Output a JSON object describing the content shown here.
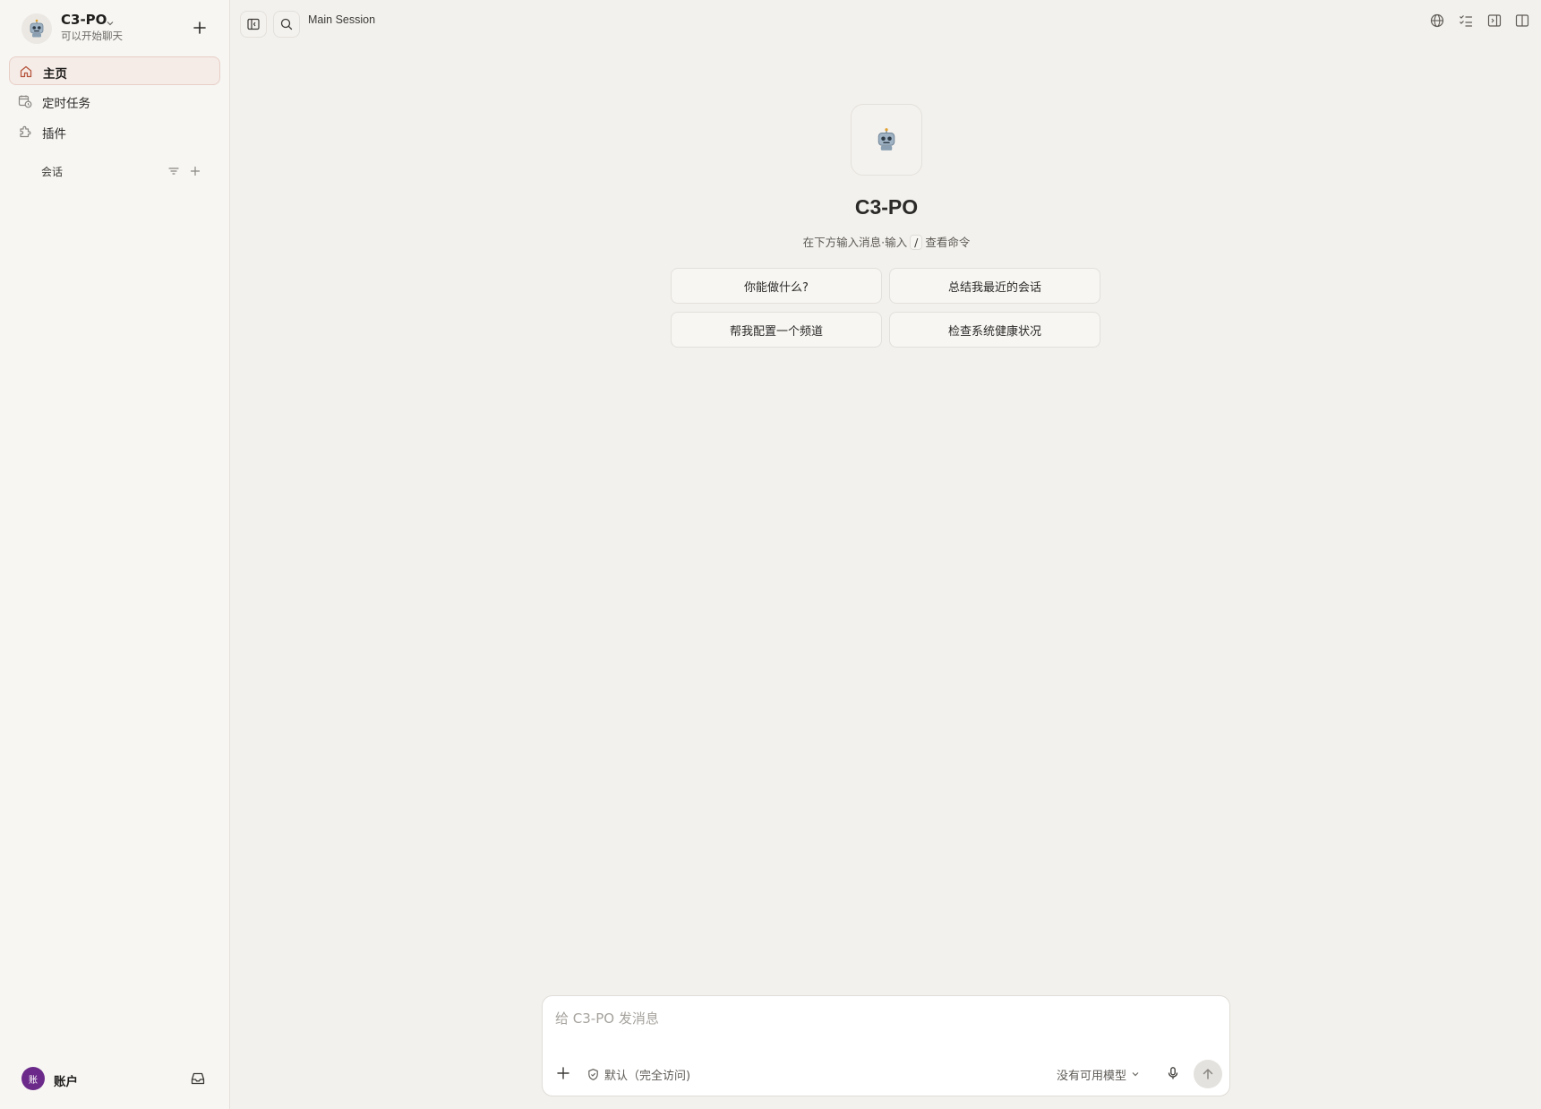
{
  "sidebar": {
    "agent": {
      "name": "C3-PO",
      "status": "可以开始聊天",
      "avatar_icon": "robot-icon"
    },
    "nav": [
      {
        "label": "主页",
        "icon": "home-icon",
        "active": true
      },
      {
        "label": "定时任务",
        "icon": "calendar-clock-icon",
        "active": false
      },
      {
        "label": "插件",
        "icon": "puzzle-icon",
        "active": false
      }
    ],
    "sessions_section": {
      "title": "会话"
    },
    "account": {
      "avatar_text": "账",
      "label": "账户",
      "avatar_color": "#6b2a8a"
    }
  },
  "topbar": {
    "session_title": "Main Session",
    "icons": [
      "sidebar-toggle-icon",
      "search-icon",
      "globe-icon",
      "checklist-icon",
      "panel-left-icon",
      "split-view-icon"
    ]
  },
  "welcome": {
    "title": "C3-PO",
    "hint_prefix": "在下方输入消息·输入",
    "hint_key": "/",
    "hint_suffix": "查看命令",
    "suggestions": [
      "你能做什么?",
      "总结我最近的会话",
      "帮我配置一个频道",
      "检查系统健康状况"
    ]
  },
  "composer": {
    "placeholder": "给 C3-PO 发消息",
    "value": "",
    "permission": "默认（完全访问)",
    "model": "没有可用模型"
  },
  "colors": {
    "accent_active_bg": "#f5ebe7",
    "accent_active_border": "#e8cfc6",
    "page_bg": "#f3f1ed"
  }
}
